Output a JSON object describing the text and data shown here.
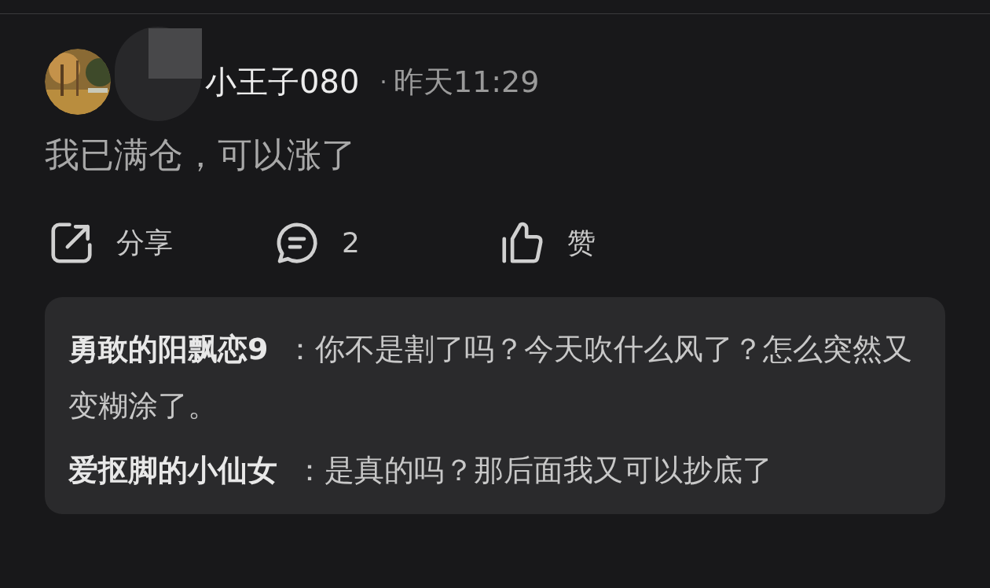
{
  "post": {
    "author": "小王子080",
    "separator": "·",
    "time": "昨天11:29",
    "content": "我已满仓，可以涨了",
    "actions": [
      {
        "kind": "share",
        "label": "分享"
      },
      {
        "kind": "comment",
        "label": "2"
      },
      {
        "kind": "like",
        "label": "赞"
      }
    ]
  },
  "replies": [
    {
      "name": "勇敢的阳飘恋9",
      "text": "：你不是割了吗？今天吹什么风了？怎么突然又变糊涂了。"
    },
    {
      "name": "爱抠脚的小仙女",
      "text": "：是真的吗？那后面我又可以抄底了"
    }
  ]
}
